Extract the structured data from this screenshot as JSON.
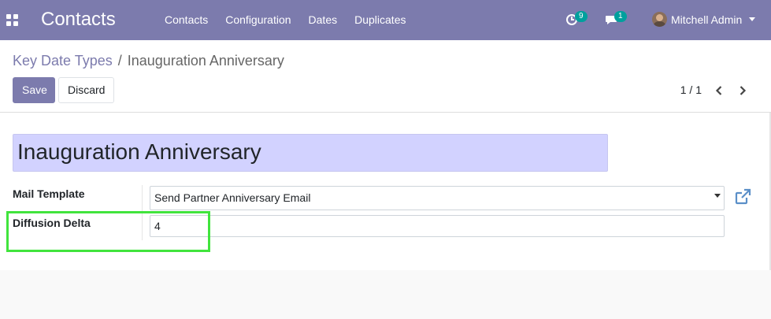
{
  "navbar": {
    "app_title": "Contacts",
    "menu": [
      "Contacts",
      "Configuration",
      "Dates",
      "Duplicates"
    ],
    "activity_count": "9",
    "message_count": "1",
    "user_name": "Mitchell Admin"
  },
  "breadcrumb": {
    "parent": "Key Date Types",
    "separator": "/",
    "current": "Inauguration Anniversary"
  },
  "buttons": {
    "save": "Save",
    "discard": "Discard"
  },
  "pager": {
    "value": "1 / 1"
  },
  "form": {
    "name": "Inauguration Anniversary",
    "mail_template_label": "Mail Template",
    "mail_template_value": "Send Partner Anniversary Email",
    "diffusion_delta_label": "Diffusion Delta",
    "diffusion_delta_value": "4"
  },
  "colors": {
    "navbar": "#7c7bad",
    "title_input_bg": "#d2d2ff",
    "highlight": "#41e43d",
    "badge": "#00a09d"
  },
  "icons": [
    "apps-grid-icon",
    "activity-clock-icon",
    "chat-bubble-icon",
    "chevron-left-icon",
    "chevron-right-icon",
    "external-link-icon",
    "dropdown-caret-icon"
  ]
}
